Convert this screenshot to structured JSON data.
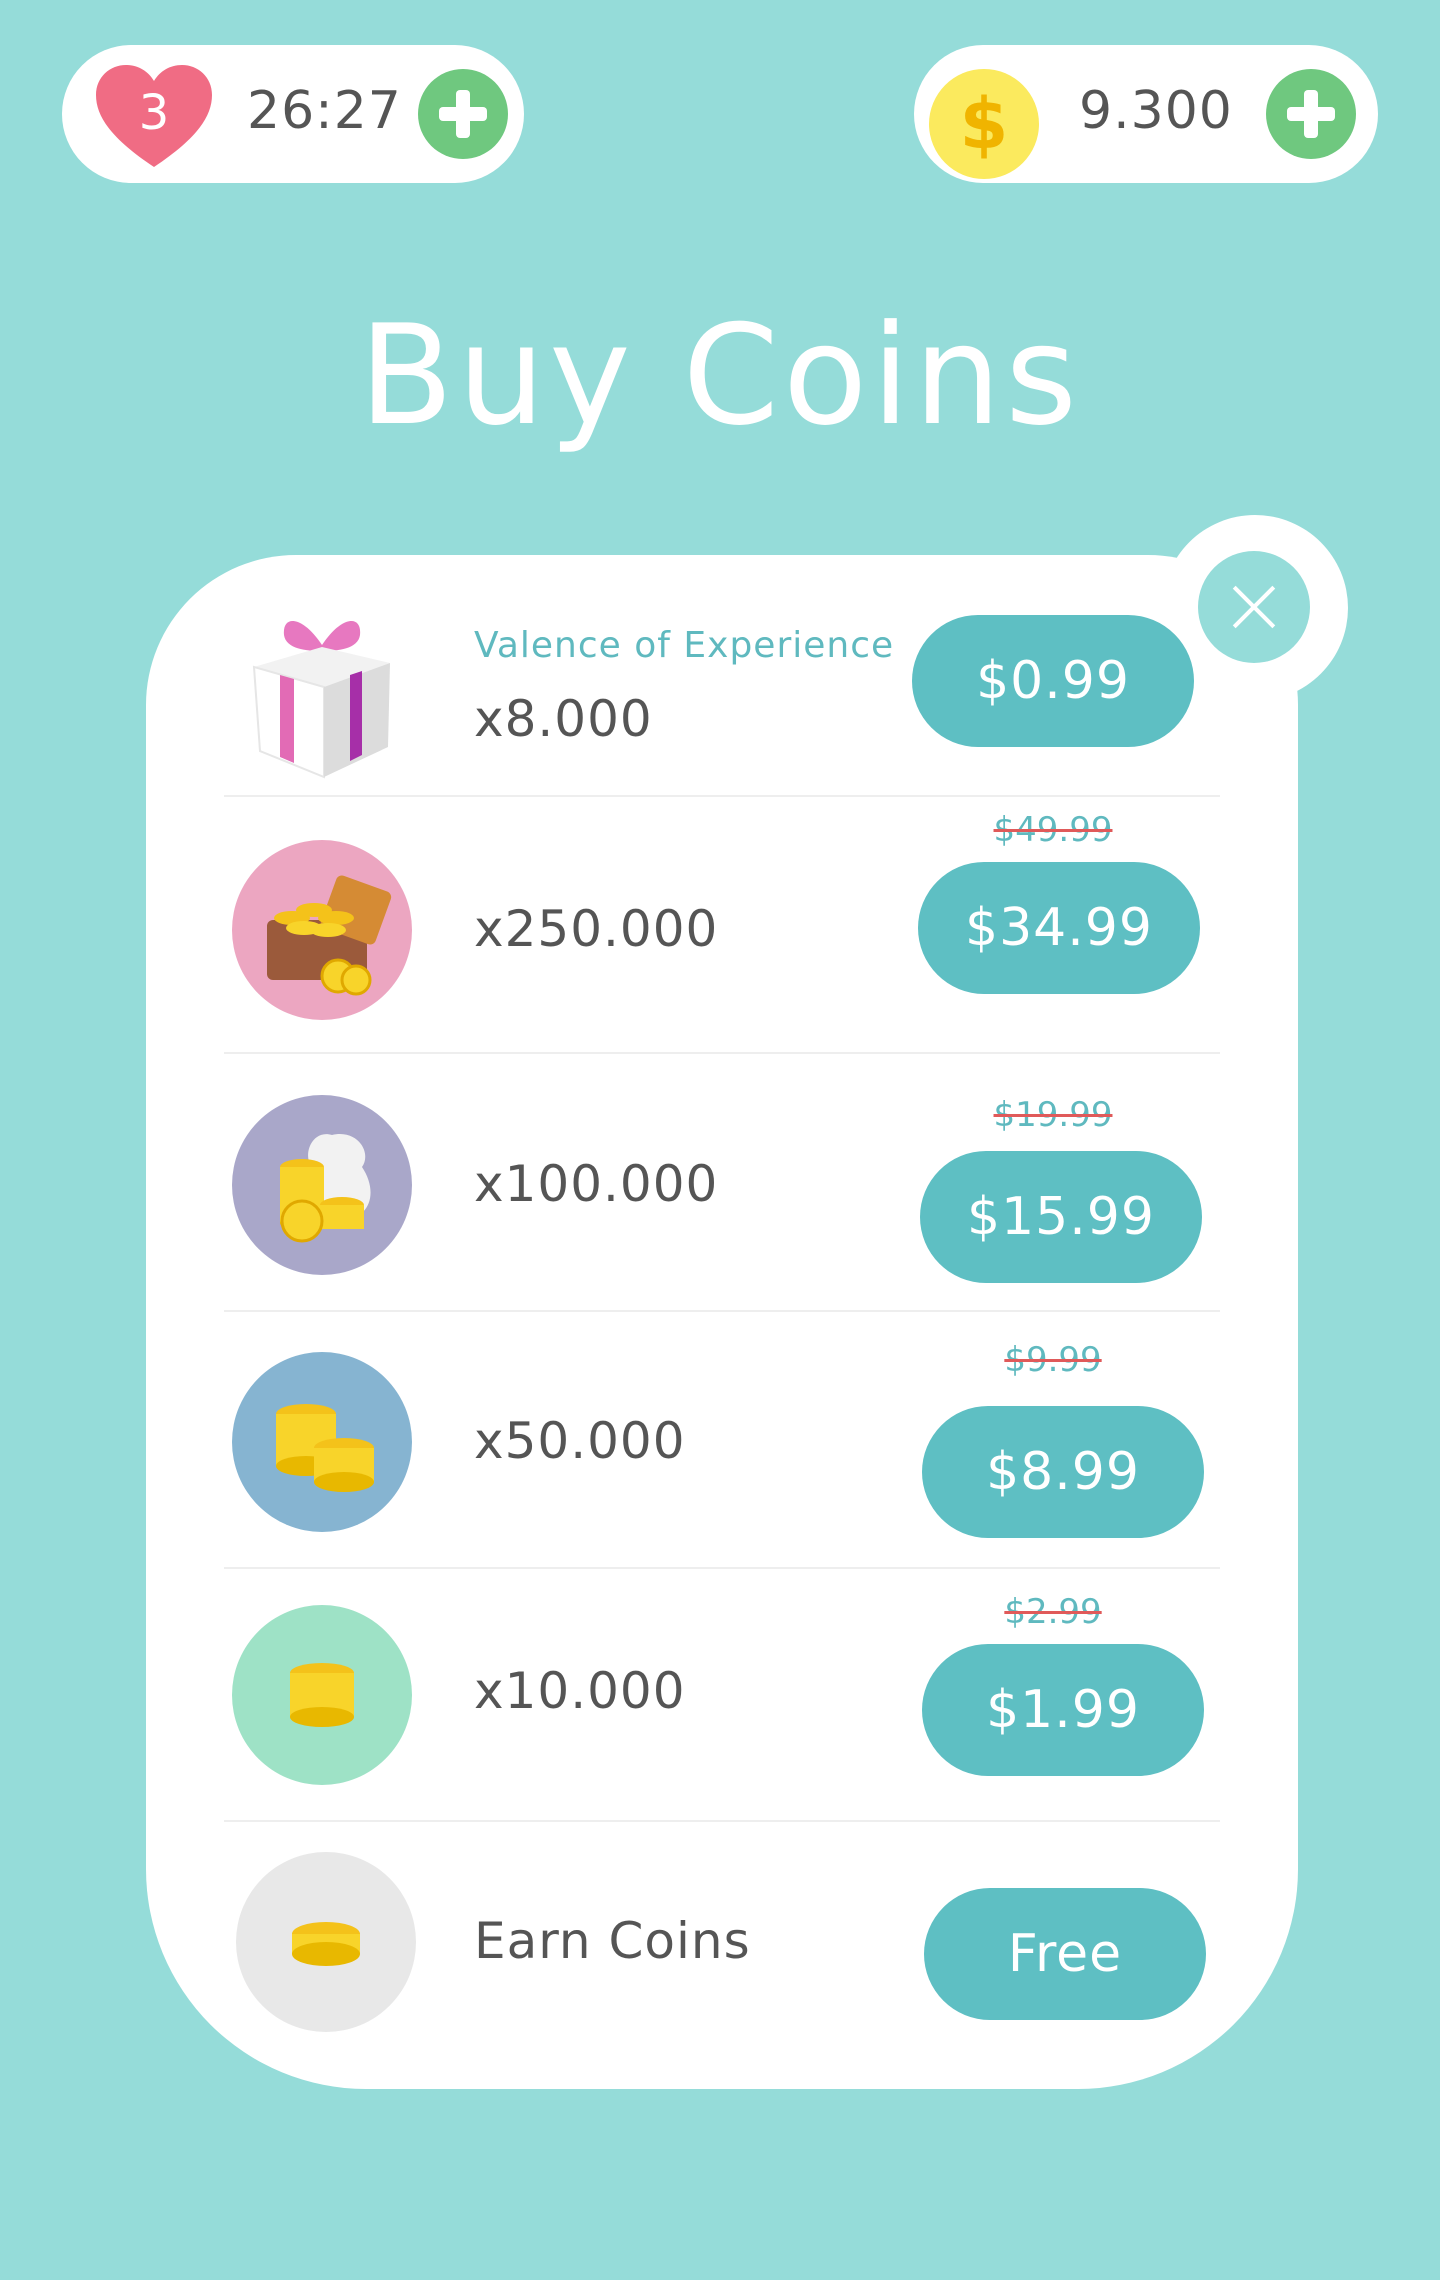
{
  "hud": {
    "lives": "3",
    "timer": "26:27",
    "coin_balance": "9.300",
    "coin_symbol": "$"
  },
  "title": "Buy Coins",
  "packages": [
    {
      "subtitle": "Valence of Experience",
      "quantity": "x8.000",
      "price": "$0.99",
      "old_price": "",
      "icon": "gift-box-icon",
      "icon_bg": "#ffffff"
    },
    {
      "quantity": "x250.000",
      "price": "$34.99",
      "old_price": "$49.99",
      "icon": "treasure-chest-icon",
      "icon_bg": "#eca6c1"
    },
    {
      "quantity": "x100.000",
      "price": "$15.99",
      "old_price": "$19.99",
      "icon": "money-bag-icon",
      "icon_bg": "#a9a7c9"
    },
    {
      "quantity": "x50.000",
      "price": "$8.99",
      "old_price": "$9.99",
      "icon": "coin-stacks-icon",
      "icon_bg": "#86b4d1"
    },
    {
      "quantity": "x10.000",
      "price": "$1.99",
      "old_price": "$2.99",
      "icon": "coin-stack-icon",
      "icon_bg": "#9ee2c6"
    },
    {
      "quantity": "Earn Coins",
      "price": "Free",
      "old_price": "",
      "icon": "coin-icon",
      "icon_bg": "#e8e8e8"
    }
  ],
  "colors": {
    "background": "#95dcd9",
    "button": "#5ebfc3",
    "accent_text": "#5fb9bf",
    "strike": "#e05a5a",
    "heart": "#f06c84",
    "plus": "#6fc87f",
    "coin": "#fbea5e"
  }
}
